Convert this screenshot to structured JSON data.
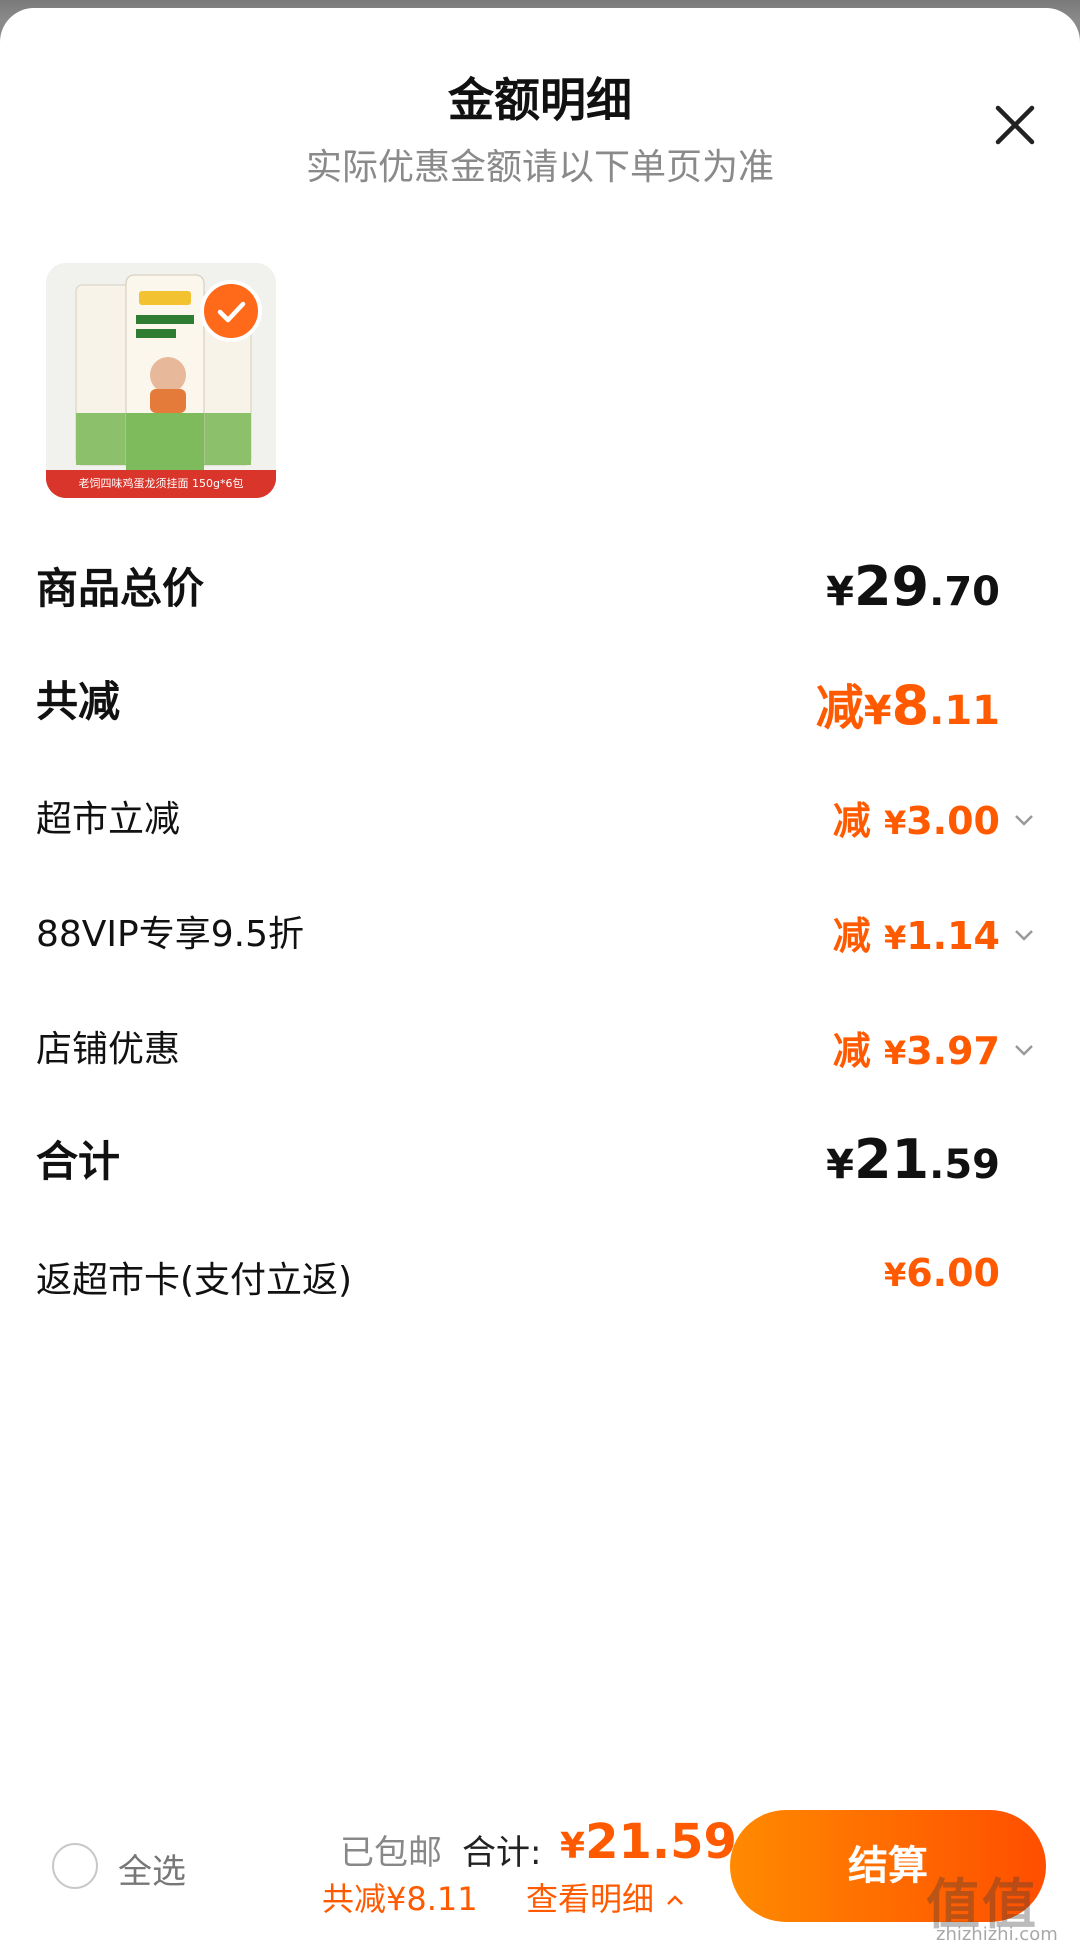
{
  "header": {
    "title": "金额明细",
    "subtitle": "实际优惠金额请以下单页为准"
  },
  "product": {
    "caption": "老饲四味鸡蛋龙须挂面 150g*6包",
    "icon": "product-image"
  },
  "lines": {
    "goods_total": {
      "label": "商品总价",
      "yen": "¥",
      "int": "29",
      "dec": ".70"
    },
    "total_reduce": {
      "label": "共减",
      "prefix": "减",
      "yen": "¥",
      "int": "8",
      "dec": ".11"
    },
    "market_reduce": {
      "label": "超市立减",
      "prefix": "减",
      "yen": "¥",
      "amount": "3.00"
    },
    "vip": {
      "label": "88VIP专享9.5折",
      "prefix": "减",
      "yen": "¥",
      "amount": "1.14"
    },
    "store": {
      "label": "店铺优惠",
      "prefix": "减",
      "yen": "¥",
      "amount": "3.97"
    },
    "subtotal": {
      "label": "合计",
      "yen": "¥",
      "int": "21",
      "dec": ".59"
    },
    "card": {
      "label": "返超市卡(支付立返)",
      "yen": "¥",
      "amount": "6.00"
    }
  },
  "footer": {
    "select_all": "全选",
    "shipped": "已包邮",
    "total_label": "合计:",
    "total_yen": "¥",
    "total_value": "21.59",
    "saved": "共减¥8.11",
    "detail": "查看明细",
    "checkout": "结算"
  },
  "watermark": {
    "main": "值值值",
    "sub": "zhizhizhi.com"
  },
  "colors": {
    "accent": "#ff5a00",
    "text": "#111111",
    "muted": "#8a8a8a"
  }
}
